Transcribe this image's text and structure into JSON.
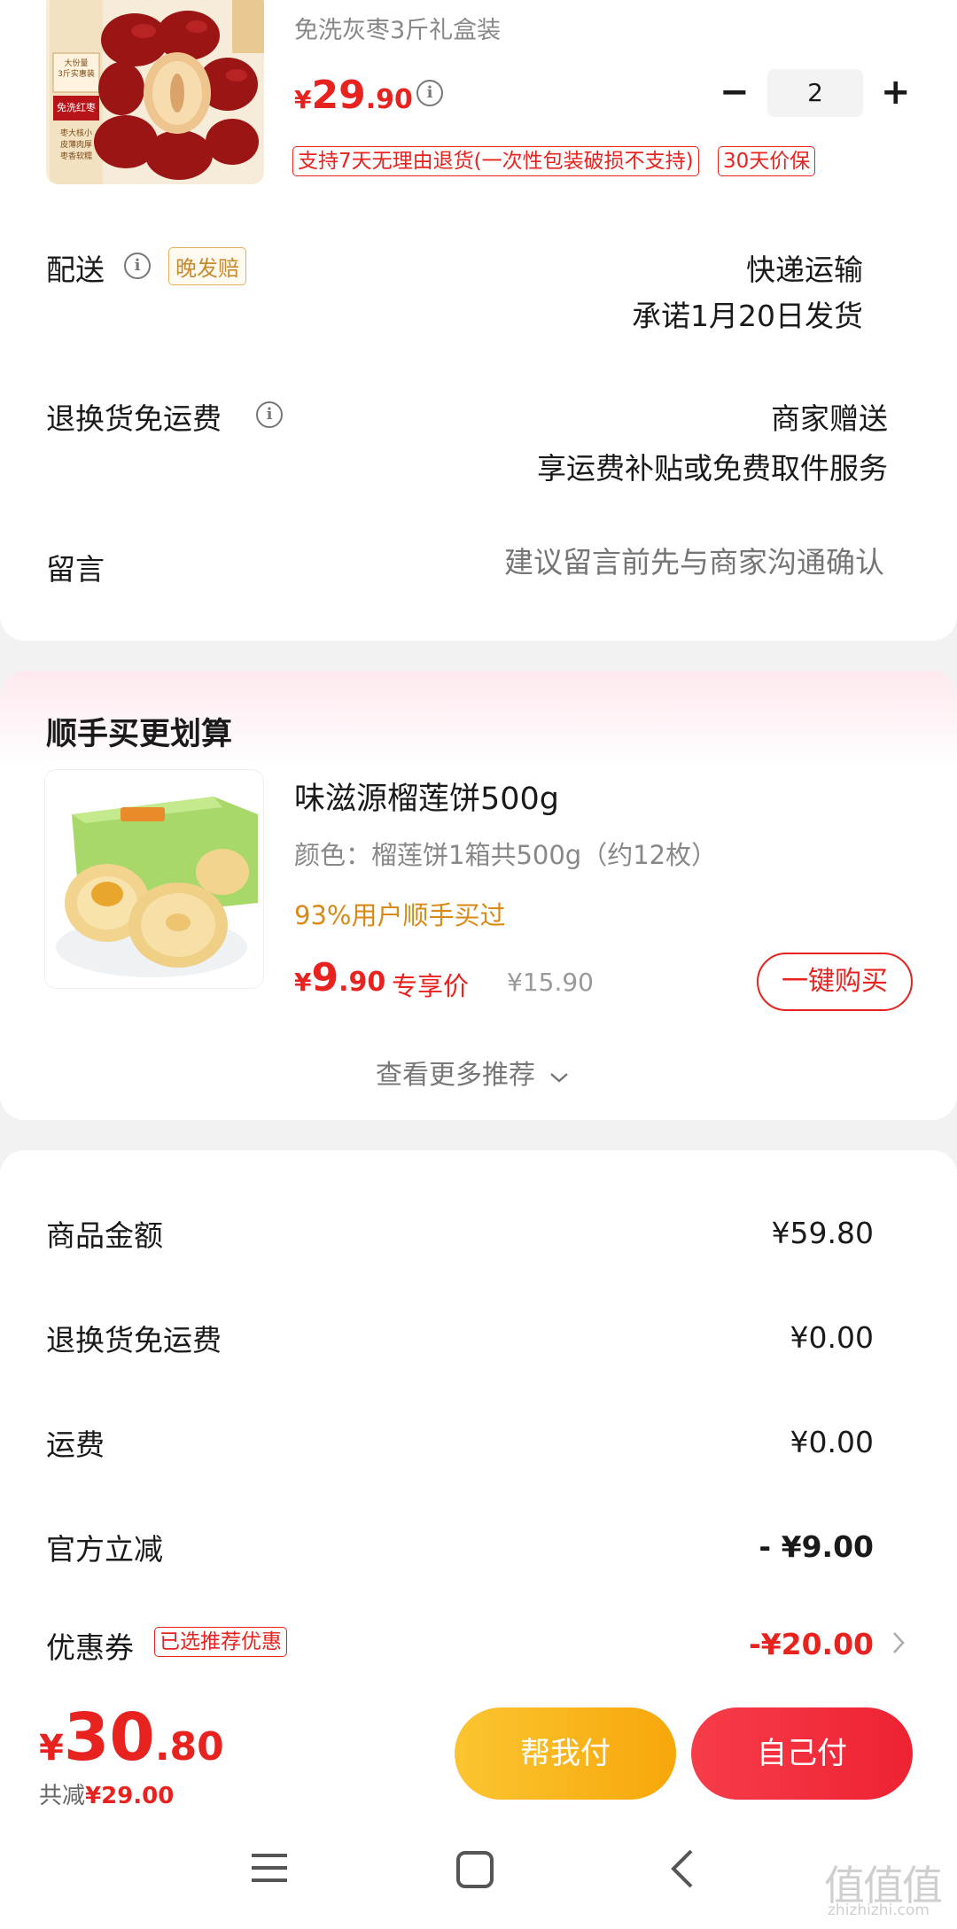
{
  "product": {
    "subtitle": "免洗灰枣3斤礼盒装",
    "price_symbol": "¥",
    "price_int": "29",
    "price_dec": ".90",
    "qty_minus": "−",
    "qty": "2",
    "qty_plus": "+",
    "tag_return": "支持7天无理由退货(一次性包装破损不支持)",
    "tag_price_protect": "30天价保",
    "image_text": {
      "badge": "大份量\n3斤实惠装",
      "banner": "免洗红枣",
      "notes": "枣大核小\n皮薄肉厚\n枣香软糯"
    }
  },
  "delivery": {
    "label": "配送",
    "badge": "晚发赔",
    "method": "快递运输",
    "promise": "承诺1月20日发货"
  },
  "return_shipping": {
    "label": "退换货免运费",
    "value": "商家赠送",
    "desc": "享运费补贴或免费取件服务"
  },
  "message": {
    "label": "留言",
    "placeholder": "建议留言前先与商家沟通确认"
  },
  "upsell": {
    "section_title": "顺手买更划算",
    "item_title": "味滋源榴莲饼500g",
    "variant": "颜色：榴莲饼1箱共500g（约12枚）",
    "social": "93%用户顺手买过",
    "price_symbol": "¥",
    "price_int": "9",
    "price_dec": ".90",
    "price_tag": "专享价",
    "orig_price": "¥15.90",
    "buy_button": "一键购买",
    "more": "查看更多推荐"
  },
  "summary": {
    "rows": [
      {
        "label": "商品金额",
        "value": "¥59.80"
      },
      {
        "label": "退换货免运费",
        "value": "¥0.00"
      },
      {
        "label": "运费",
        "value": "¥0.00"
      },
      {
        "label": "官方立减",
        "value": "- ¥9.00"
      },
      {
        "label": "优惠券",
        "value": "-¥20.00",
        "badge": "已选推荐优惠"
      }
    ]
  },
  "footer": {
    "total_symbol": "¥",
    "total_int": "30",
    "total_dec": ".80",
    "saved_label": "共减",
    "saved_value": "¥29.00",
    "help_pay": "帮我付",
    "self_pay": "自己付"
  },
  "watermark": {
    "logo": "值值值",
    "site": "zhizhizhi.com"
  },
  "colors": {
    "accent_red": "#e8231f",
    "gold": "#f7a70a",
    "background": "#f2f2f2"
  }
}
